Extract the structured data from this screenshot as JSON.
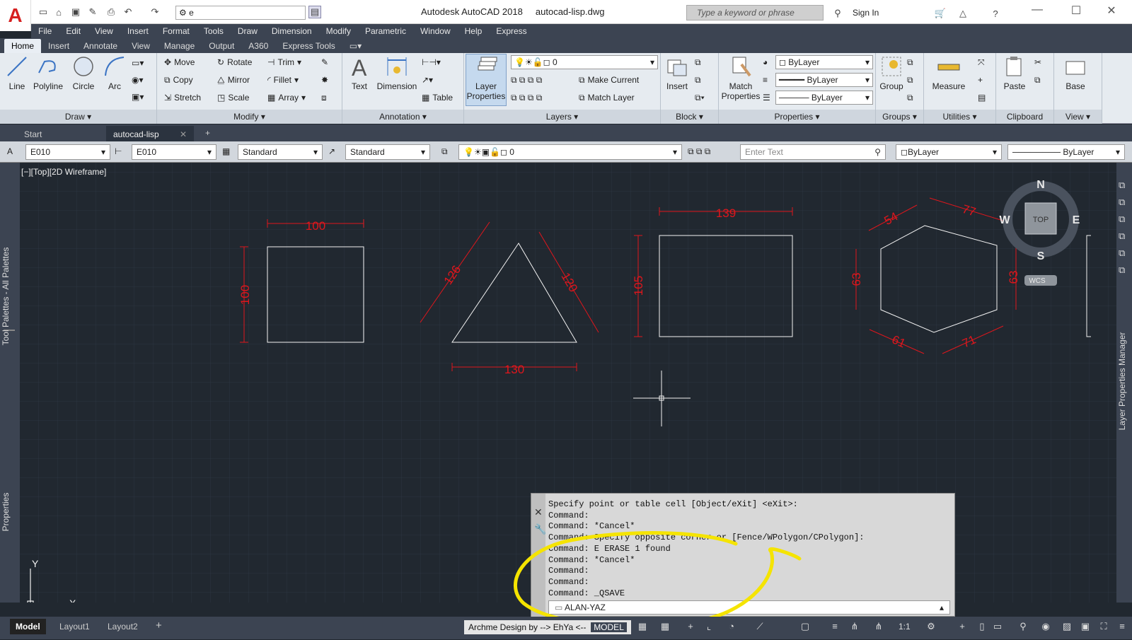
{
  "app": {
    "logo": "A",
    "title": "Autodesk AutoCAD 2018",
    "document": "autocad-lisp.dwg",
    "workspace": "e",
    "search_placeholder": "Type a keyword or phrase",
    "sign_in": "Sign In"
  },
  "menus": [
    "File",
    "Edit",
    "View",
    "Insert",
    "Format",
    "Tools",
    "Draw",
    "Dimension",
    "Modify",
    "Parametric",
    "Window",
    "Help",
    "Express"
  ],
  "ribbon_tabs": [
    "Home",
    "Insert",
    "Annotate",
    "View",
    "Manage",
    "Output",
    "A360",
    "Express Tools"
  ],
  "ribbon": {
    "draw": {
      "title": "Draw",
      "line": "Line",
      "polyline": "Polyline",
      "circle": "Circle",
      "arc": "Arc"
    },
    "modify": {
      "title": "Modify",
      "move": "Move",
      "rotate": "Rotate",
      "trim": "Trim",
      "copy": "Copy",
      "mirror": "Mirror",
      "fillet": "Fillet",
      "stretch": "Stretch",
      "scale": "Scale",
      "array": "Array"
    },
    "annotation": {
      "title": "Annotation",
      "text": "Text",
      "dimension": "Dimension",
      "table": "Table"
    },
    "layers": {
      "title": "Layers",
      "layer_properties": "Layer Properties",
      "layer_value": "0",
      "make_current": "Make Current",
      "match_layer": "Match Layer"
    },
    "block": {
      "title": "Block",
      "insert": "Insert"
    },
    "properties": {
      "title": "Properties",
      "match": "Match Properties",
      "color": "ByLayer",
      "lineweight": "ByLayer",
      "linetype": "ByLayer"
    },
    "groups": {
      "title": "Groups",
      "group": "Group"
    },
    "utilities": {
      "title": "Utilities",
      "measure": "Measure"
    },
    "clipboard": {
      "title": "Clipboard",
      "paste": "Paste"
    },
    "view": {
      "title": "View",
      "base": "Base"
    }
  },
  "doc_tabs": {
    "start": "Start",
    "active": "autocad-lisp",
    "close": "✕",
    "add": "+"
  },
  "propbar": {
    "text_style": "E010",
    "dim_style": "E010",
    "table_style": "Standard",
    "mleader_style": "Standard",
    "layer": "0",
    "enter_text": "Enter Text",
    "color": "ByLayer",
    "linetype": "ByLayer"
  },
  "viewport": {
    "caption": "[−][Top][2D Wireframe]"
  },
  "viewcube": {
    "n": "N",
    "s": "S",
    "e": "E",
    "w": "W",
    "face": "TOP",
    "ucs": "WCS"
  },
  "dims": {
    "square_w": "100",
    "square_h": "100",
    "tri_left": "126",
    "tri_right": "120",
    "tri_base": "130",
    "rect_w": "139",
    "rect_h": "105",
    "hex_tl": "54",
    "hex_tr": "77",
    "hex_l": "63",
    "hex_r": "63",
    "hex_bl": "61",
    "hex_br": "71"
  },
  "ucs": {
    "x": "X",
    "y": "Y"
  },
  "side_labels": {
    "tool_palettes": "Tool Palettes - All Palettes",
    "properties": "Properties",
    "layer_manager": "Layer Properties Manager"
  },
  "command": {
    "lines": [
      "Specify point or table cell [Object/eXit] <eXit>:",
      "Command:",
      "Command: *Cancel*",
      "Command: Specify opposite corner or [Fence/WPolygon/CPolygon]:",
      "Command: E ERASE 1 found",
      "Command: *Cancel*",
      "Command:",
      "Command:",
      "Command: _QSAVE"
    ],
    "input": "ALAN-YAZ"
  },
  "layout_tabs": [
    "Model",
    "Layout1",
    "Layout2"
  ],
  "status": {
    "archme": "Archme Design by --> EhYa <--",
    "model": "MODEL",
    "scale": "1:1"
  },
  "colors": {
    "accent": "#d62020",
    "dim_red": "#e0161c",
    "highlight": "#f5e400",
    "canvas": "#212830"
  }
}
